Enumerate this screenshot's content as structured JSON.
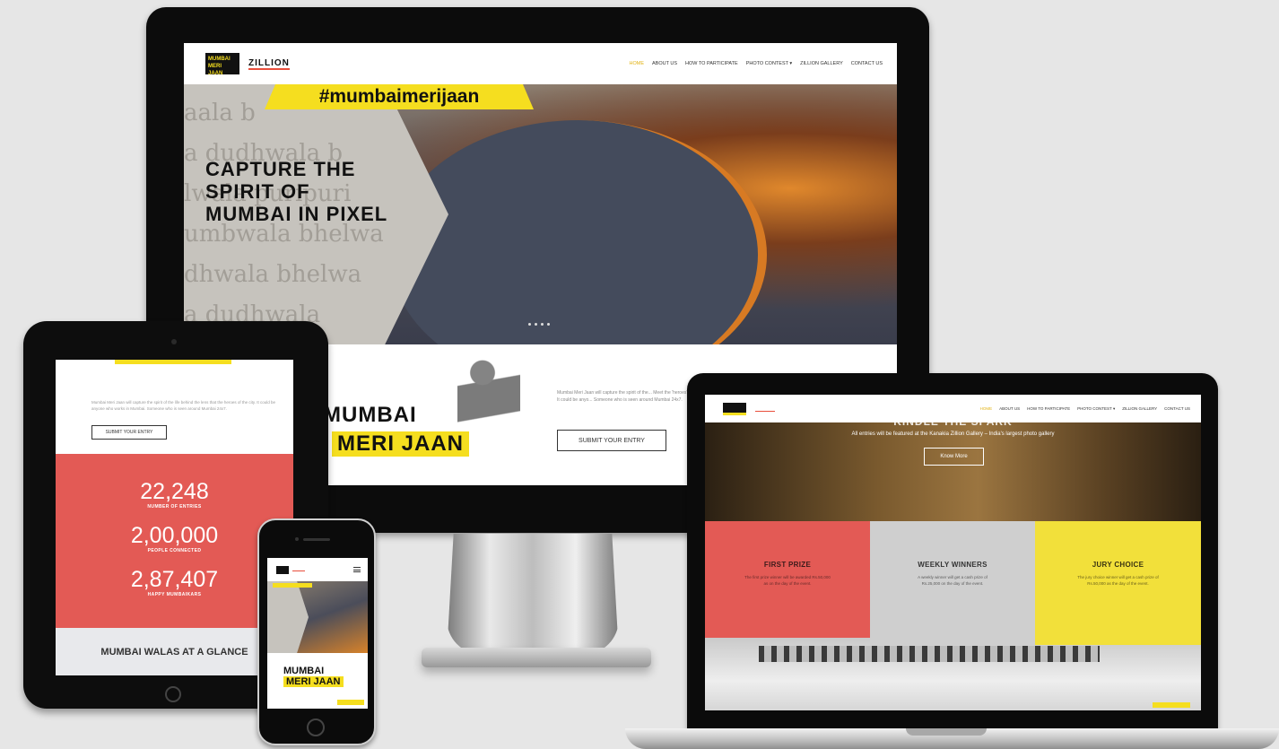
{
  "site": {
    "logo_mm_line1": "MUMBAI",
    "logo_mm_line2": "MERI JAAN",
    "logo_z": "ZILLION",
    "nav": [
      "HOME",
      "ABOUT US",
      "HOW TO PARTICIPATE",
      "PHOTO CONTEST ▾",
      "ZILLION GALLERY",
      "CONTACT US"
    ]
  },
  "desktop": {
    "hashtag": "#mumbaimerijaan",
    "headline": "CAPTURE THE SPIRIT OF MUMBAI IN PIXEL",
    "bg_words": [
      "aala b",
      "a dudhwala b",
      "lwala puripuri",
      "umbwala bhelwa",
      "dhwala bhelwa",
      "a dudhwala"
    ],
    "slide_count": 4,
    "intro_logo_line1": "MUMBAI",
    "intro_logo_line2": "MERI JAAN",
    "intro_text": "Mumbai Meri Jaan will capture the spirit of the... Meet the 'heroes' of the city. It could be anyo... Someone who is seen around Mumbai 24x7.",
    "submit_label": "SUBMIT YOUR ENTRY"
  },
  "tablet": {
    "text": "Mumbai Meri Jaan will capture the spirit of the life behind the lens that the heroes of the city. It could be anyone who works in Mumbai. Someone who is seen around Mumbai 24x7.",
    "submit_label": "SUBMIT YOUR ENTRY",
    "stats": [
      {
        "value": "22,248",
        "label": "NUMBER OF ENTRIES"
      },
      {
        "value": "2,00,000",
        "label": "PEOPLE CONNECTED"
      },
      {
        "value": "2,87,407",
        "label": "HAPPY MUMBAIKARS"
      }
    ],
    "glance_title": "MUMBAI WALAS AT A GLANCE"
  },
  "phone": {
    "logo_line1": "MUMBAI",
    "logo_line2": "MERI JAAN",
    "menu_icon": "hamburger-icon"
  },
  "laptop": {
    "heading": "KINDLE THE SPARK",
    "subtext": "All entries will be featured at the Kanakia Zillion Gallery – India's largest photo gallery",
    "know_more": "Know More",
    "boxes": [
      {
        "title": "FIRST PRIZE",
        "text": "The first prize winner will be awarded Rs.50,000 as on the day of the event.",
        "color": "#e35a55"
      },
      {
        "title": "WEEKLY WINNERS",
        "text": "A weekly winner will get a cash prize of Rs.25,000 on the day of the event.",
        "color": "#cfcfcf"
      },
      {
        "title": "JURY CHOICE",
        "text": "The jury choice winner will get a cash prize of Rs.50,000 as the day of the event.",
        "color": "#f2e03a"
      }
    ]
  },
  "colors": {
    "accent_yellow": "#f5de1f",
    "accent_red": "#e35a55",
    "device_black": "#0c0c0c"
  }
}
